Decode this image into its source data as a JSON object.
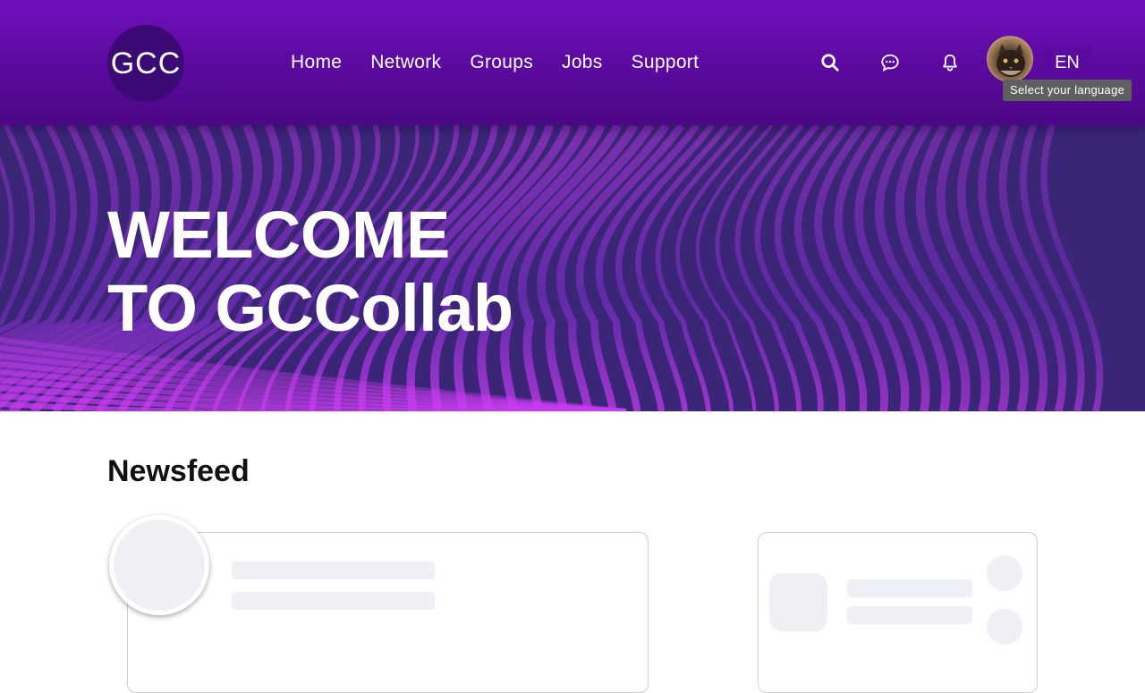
{
  "header": {
    "logo_text": "GCC",
    "nav": [
      {
        "label": "Home"
      },
      {
        "label": "Network"
      },
      {
        "label": "Groups"
      },
      {
        "label": "Jobs"
      },
      {
        "label": "Support"
      }
    ],
    "icons": {
      "search": "search-icon",
      "messages": "chat-bubble-icon",
      "notifications": "bell-icon"
    },
    "language": "EN",
    "language_tooltip": "Select your language"
  },
  "hero": {
    "line1": "WELCOME",
    "line2": "TO GCCollab"
  },
  "newsfeed": {
    "title": "Newsfeed"
  },
  "colors": {
    "header_top": "#6f0fbd",
    "header_bottom": "#4b0886",
    "hero_bg": "#3b2577",
    "accent_wave": "#c83cf0",
    "skeleton": "#eff0f5"
  }
}
